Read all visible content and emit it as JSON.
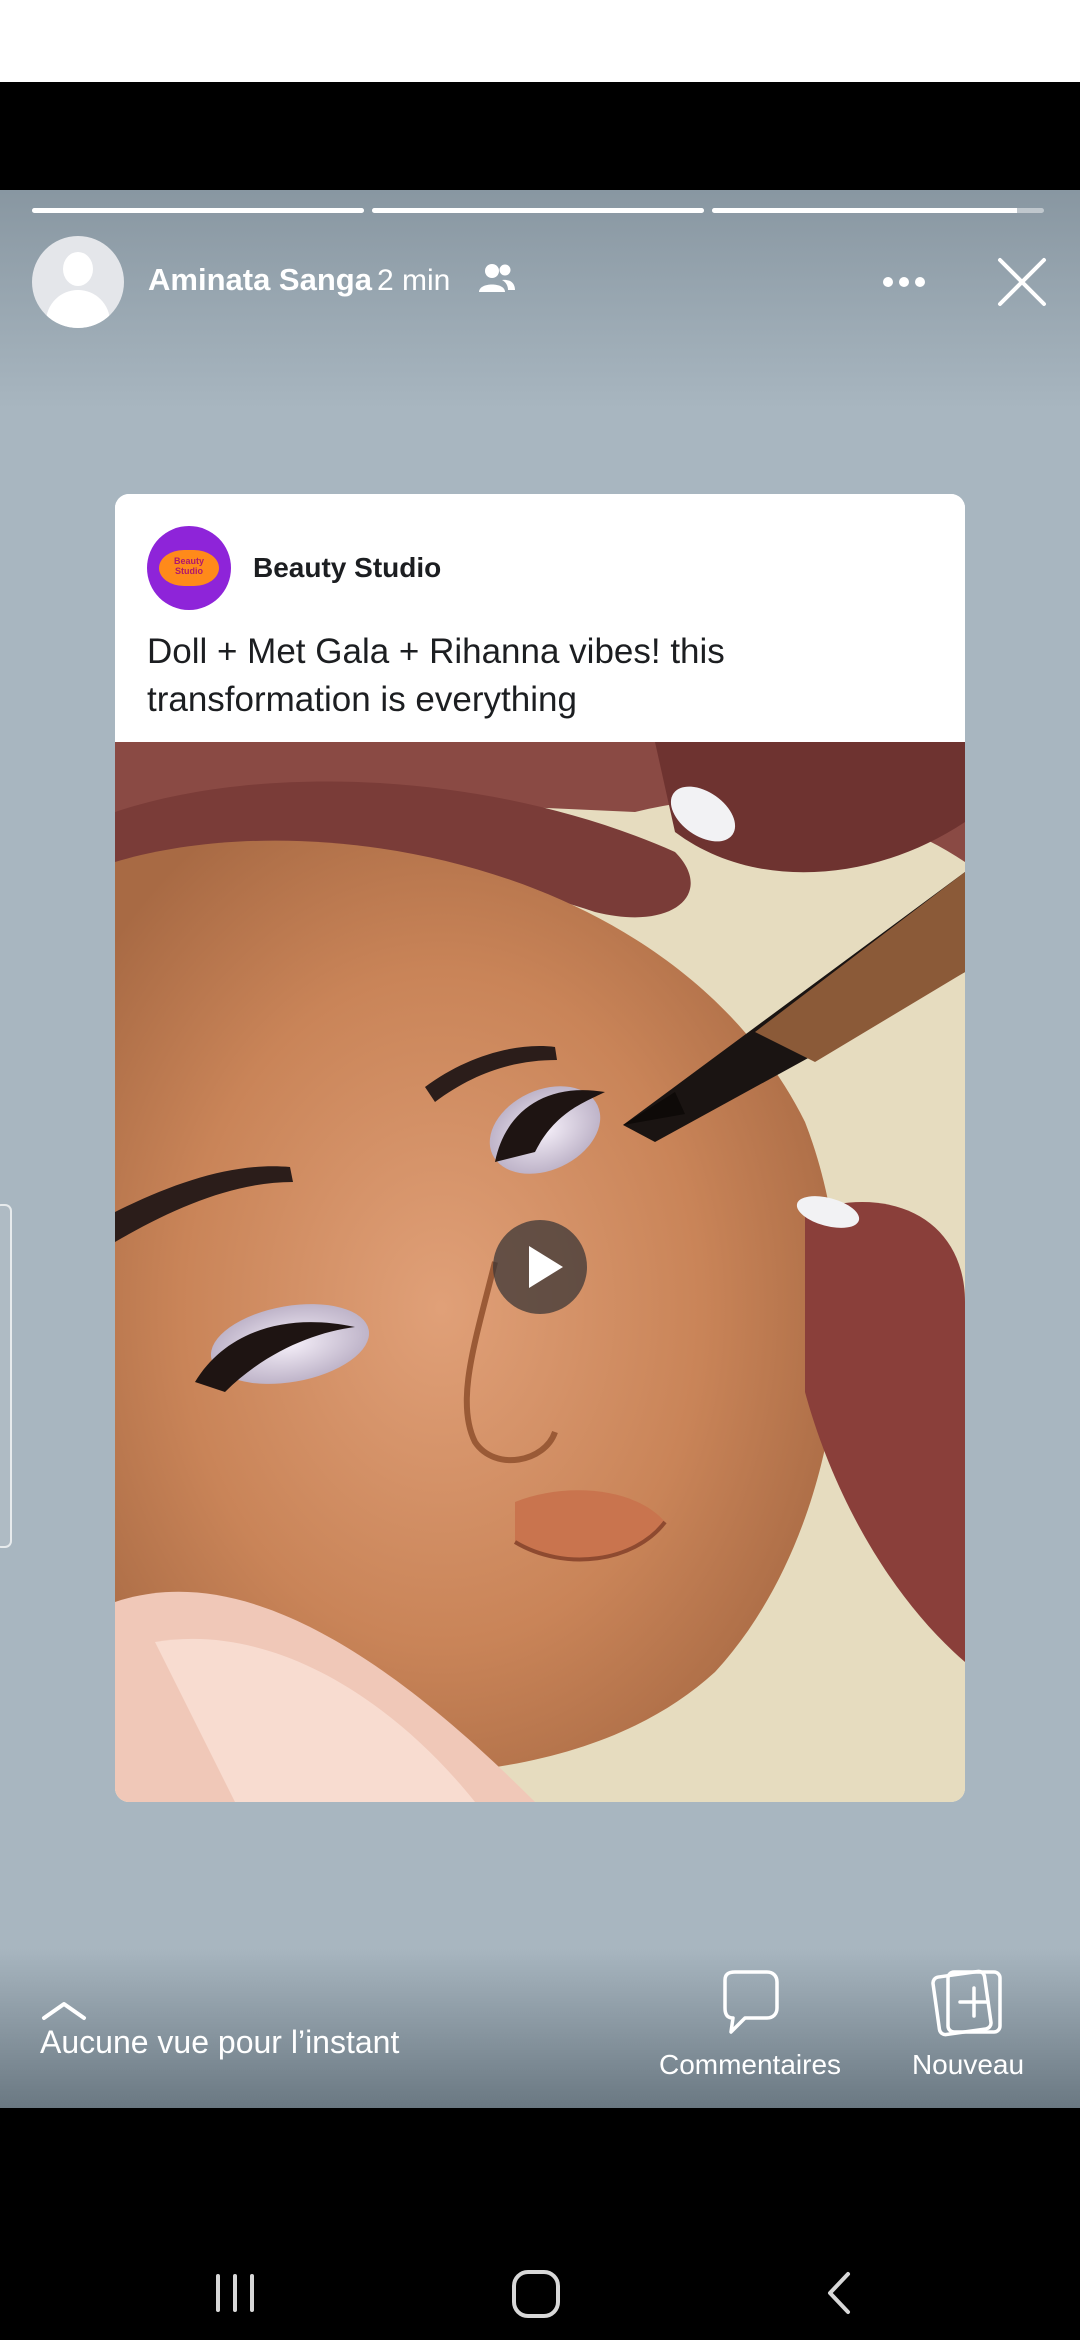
{
  "story": {
    "user_name": "Aminata Sanga",
    "post_time": "2 min",
    "progress": [
      1.0,
      1.0,
      0.92
    ],
    "icons": {
      "audience": "friends-icon",
      "more": "more-icon",
      "close": "close-icon"
    }
  },
  "shared_post": {
    "page_name": "Beauty Studio",
    "logo_text": "Beauty Studio",
    "text": "Doll + Met Gala + Rihanna vibes! this transformation is everything",
    "media_type": "video",
    "play_icon": "play-icon"
  },
  "footer": {
    "viewers_text": "Aucune vue pour l’instant",
    "comments_label": "Commentaires",
    "new_label": "Nouveau",
    "icons": {
      "expand": "chevron-up-icon",
      "comments": "comment-bubble-icon",
      "new": "add-story-icon"
    }
  },
  "system_nav": {
    "recent": "recent-apps-icon",
    "home": "home-icon",
    "back": "back-icon"
  },
  "colors": {
    "story_background": "#a8b6c0",
    "logo_purple": "#8e24d9",
    "logo_orange": "#ff8a1a"
  }
}
